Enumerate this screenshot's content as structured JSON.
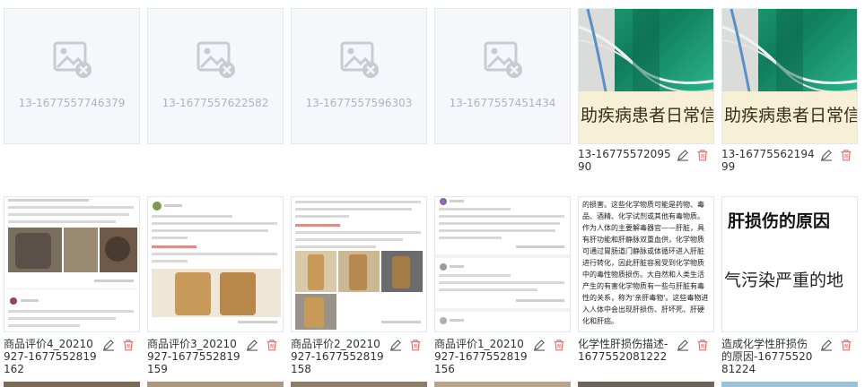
{
  "row1": [
    {
      "type": "placeholder",
      "label": "13-1677557746379"
    },
    {
      "type": "placeholder",
      "label": "13-1677557622582"
    },
    {
      "type": "placeholder",
      "label": "13-1677557596303"
    },
    {
      "type": "placeholder",
      "label": "13-1677557451434"
    },
    {
      "type": "hospital",
      "overlay": "助疾病患者日常信",
      "name": "13-1677557209590"
    },
    {
      "type": "hospital",
      "overlay": "助疾病患者日常信",
      "name": "13-1677556219499"
    }
  ],
  "row2": [
    {
      "type": "review",
      "name": "商品评价4_20210927-1677552819162"
    },
    {
      "type": "review",
      "name": "商品评价3_20210927-1677552819159"
    },
    {
      "type": "review",
      "name": "商品评价2_20210927-1677552819158"
    },
    {
      "type": "review",
      "name": "商品评价1_20210927-1677552819156"
    },
    {
      "type": "article",
      "name": "化学性肝损伤描述-1677552081222",
      "text": "的损害。这些化学物质可能是药物、毒品、酒精、化学试剂或其他有毒物质。作为人体的主要解毒器官——肝脏，具有肝功能和肝静脉双重血供，化学物质可通过胃肠道门静脉或体循环进入肝脏进行转化，因此肝脏容易受到化学物质中的毒性物质损伤。大自然和人类生活产生的有害化学物质有一些与肝脏有毒性的关系，称为'亲肝毒物'。这些毒物进入人体中会出现肝损伤、肝坏死、肝硬化和肝癌。"
    },
    {
      "type": "liver",
      "name": "造成化学性肝损伤的原因-1677552081224",
      "title": "肝损伤的原因",
      "sub": "气污染严重的地"
    }
  ],
  "colors": {
    "border": "#e4e7ed",
    "placeholder_bg": "#f5f7fa",
    "edit_icon": "#606266",
    "delete_icon": "#f56c6c"
  },
  "icons": [
    "image-placeholder-icon",
    "edit-icon",
    "delete-icon"
  ]
}
